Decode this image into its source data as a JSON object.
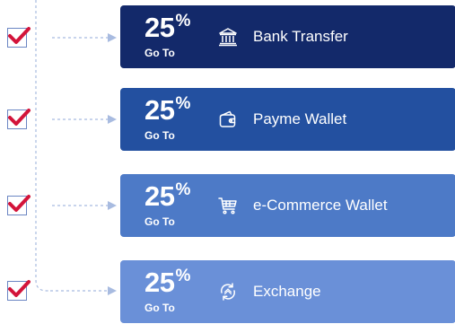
{
  "items": [
    {
      "percent": "25",
      "percent_sign": "%",
      "goto": "Go To",
      "label": "Bank Transfer",
      "icon": "bank-icon",
      "color": "#13296a",
      "checked": true
    },
    {
      "percent": "25",
      "percent_sign": "%",
      "goto": "Go To",
      "label": "Payme Wallet",
      "icon": "wallet-icon",
      "color": "#2350a0",
      "checked": true
    },
    {
      "percent": "25",
      "percent_sign": "%",
      "goto": "Go To",
      "label": "e-Commerce Wallet",
      "icon": "shopping-cart-icon",
      "color": "#4d7ac7",
      "checked": true
    },
    {
      "percent": "25",
      "percent_sign": "%",
      "goto": "Go To",
      "label": "Exchange",
      "icon": "exchange-icon",
      "color": "#6a90d8",
      "checked": true
    }
  ],
  "colors": {
    "checkbox_border": "#6b86c3",
    "checkmark": "#d3143a",
    "connector": "#a8bbe0"
  }
}
